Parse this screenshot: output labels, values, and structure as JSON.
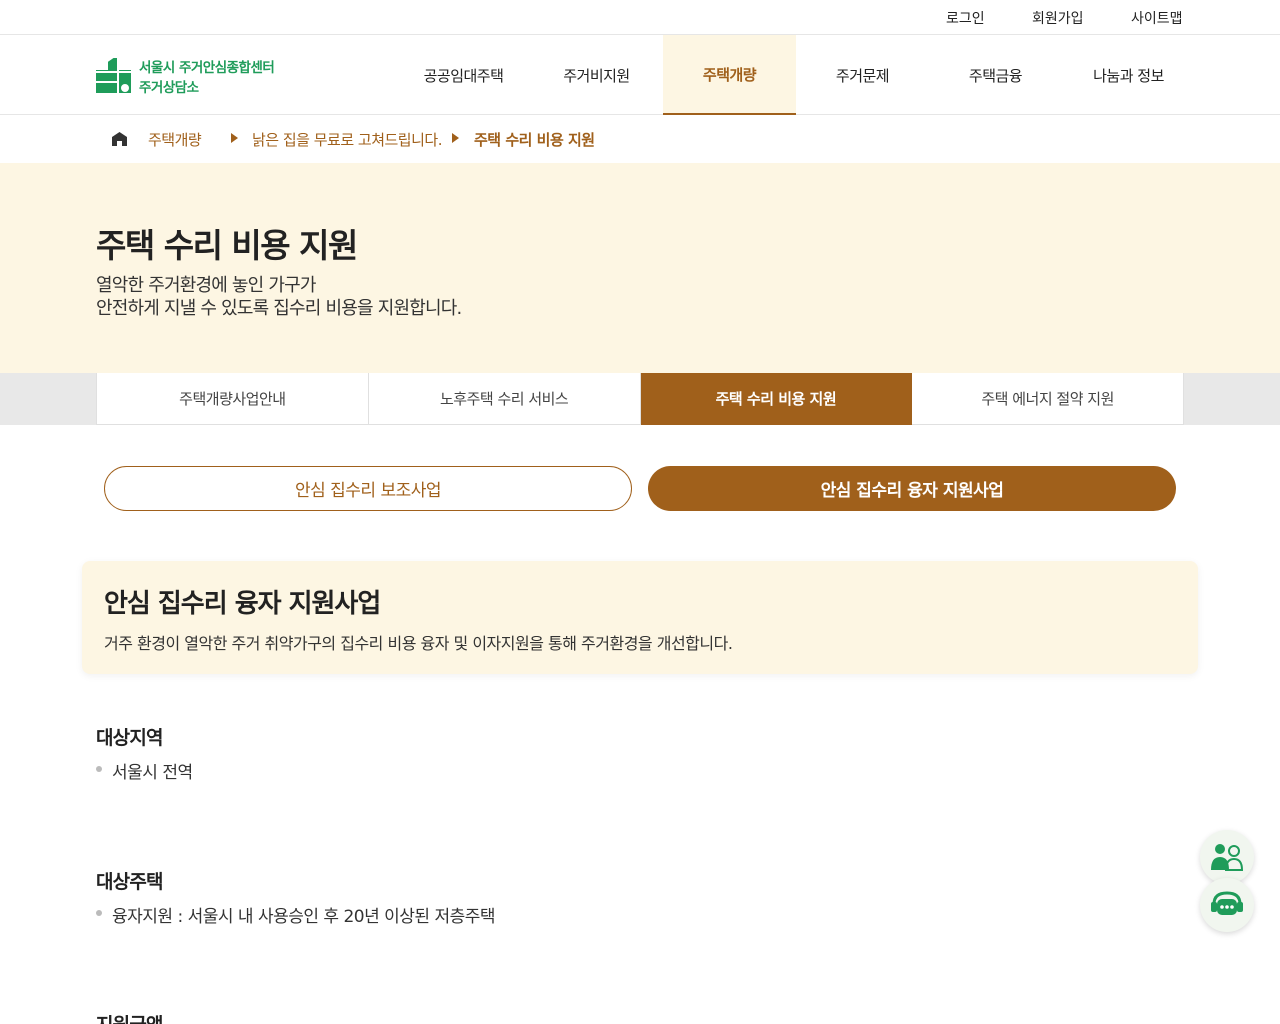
{
  "util_links": [
    "로그인",
    "회원가입",
    "사이트맵"
  ],
  "logo": {
    "line1": "서울시 주거안심종합센터",
    "line2": "주거상담소"
  },
  "gnb": [
    "공공임대주택",
    "주거비지원",
    "주택개량",
    "주거문제",
    "주택금융",
    "나눔과 정보"
  ],
  "gnb_active_index": 2,
  "breadcrumb": [
    "주택개량",
    "낡은 집을 무료로 고쳐드립니다.",
    "주택 수리 비용 지원"
  ],
  "hero": {
    "title": "주택 수리 비용 지원",
    "desc_line1": "열악한 주거환경에 놓인 가구가",
    "desc_line2": "안전하게 지낼 수 있도록 집수리 비용을 지원합니다."
  },
  "tabs": [
    "주택개량사업안내",
    "노후주택 수리 서비스",
    "주택 수리 비용 지원",
    "주택 에너지 절약 지원"
  ],
  "tab_active_index": 2,
  "sub_buttons": [
    "안심 집수리 보조사업",
    "안심 집수리 융자 지원사업"
  ],
  "sub_active_index": 1,
  "card": {
    "title": "안심 집수리 융자 지원사업",
    "desc": "거주 환경이 열악한 주거 취약가구의 집수리 비용 융자 및 이자지원을 통해 주거환경을 개선합니다."
  },
  "sections": [
    {
      "title": "대상지역",
      "items": [
        "서울시 전역"
      ]
    },
    {
      "title": "대상주택",
      "items": [
        "융자지원 : 서울시 내 사용승인 후 20년 이상된 저층주택"
      ]
    },
    {
      "title": "지원금액",
      "items": []
    }
  ],
  "colors": {
    "accent": "#a0601b",
    "hero_bg": "#fdf6e3",
    "logo_green": "#1f9c5a"
  },
  "icons": [
    "home-icon",
    "counselor-icon",
    "chatbot-icon"
  ]
}
